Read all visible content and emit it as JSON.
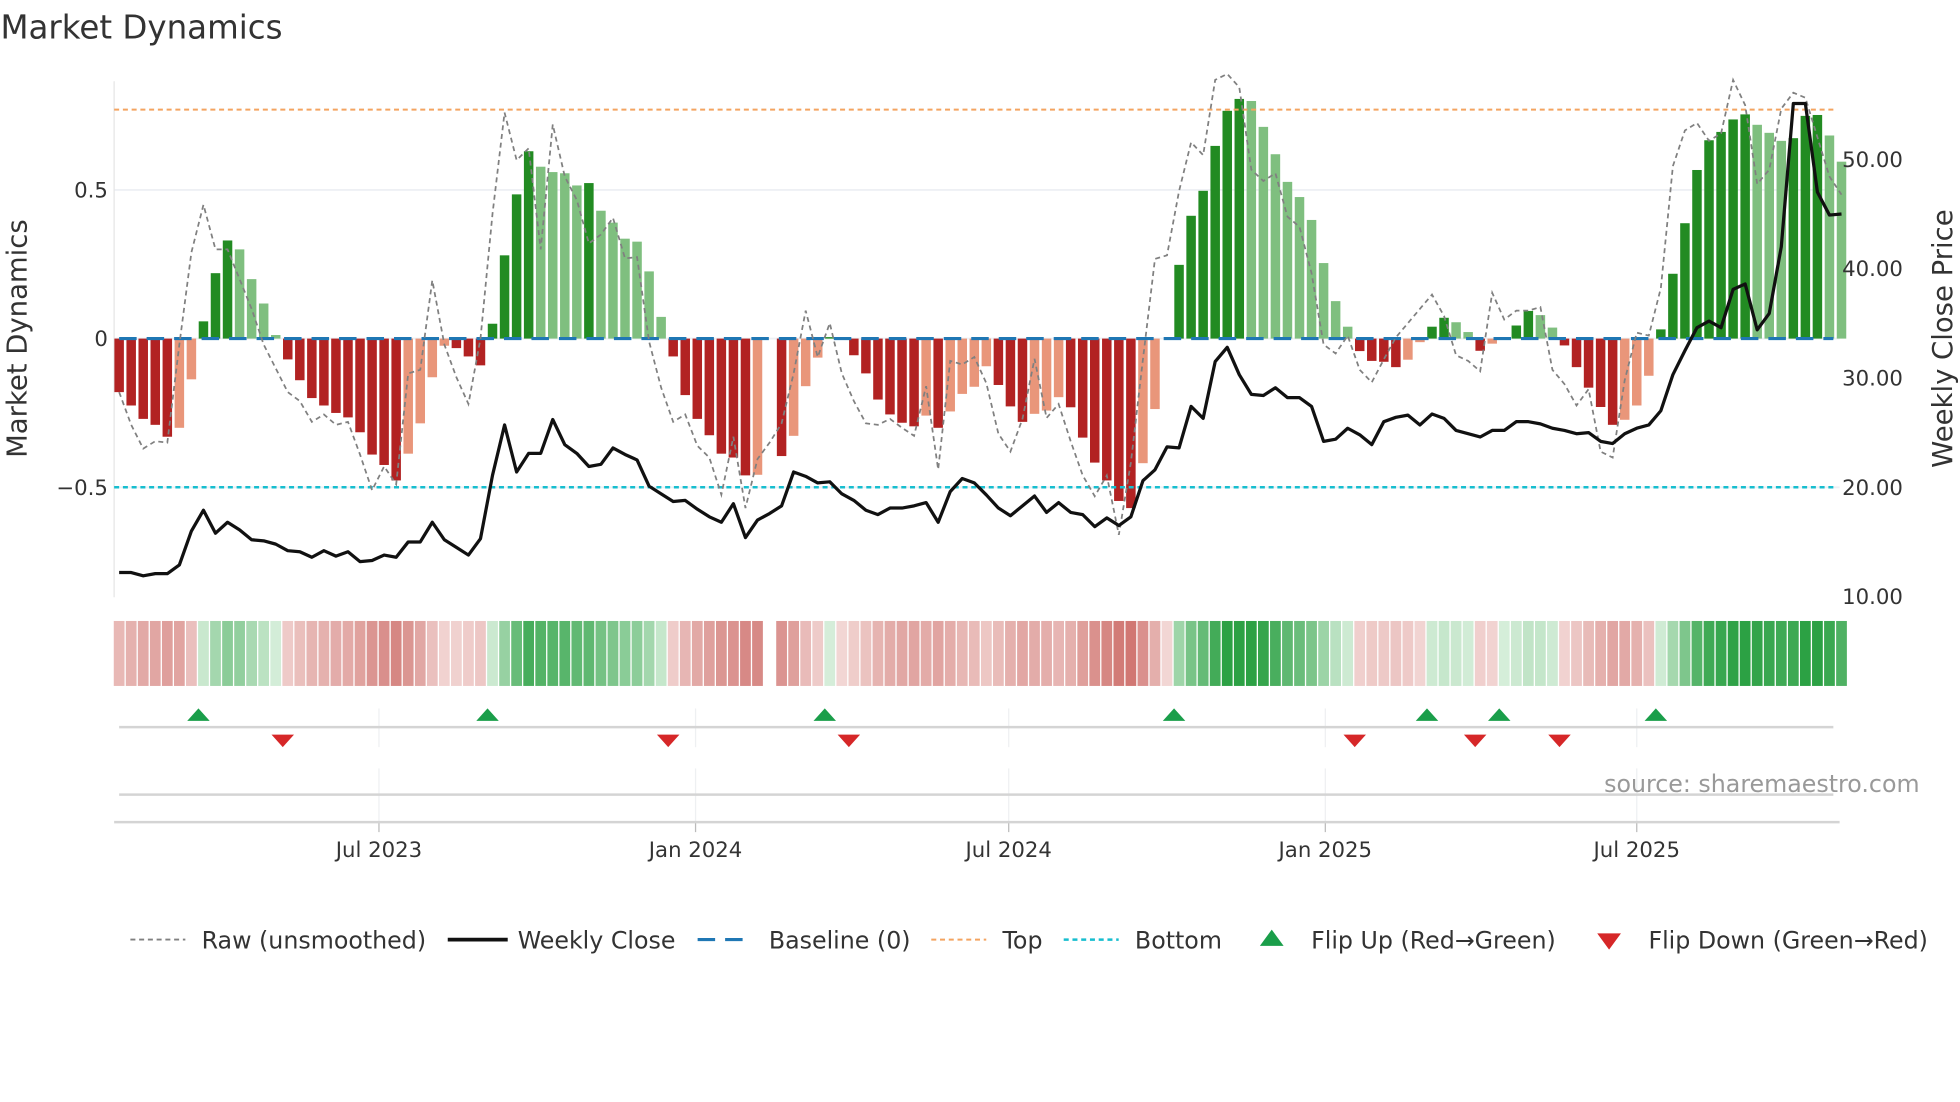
{
  "chart_data": {
    "type": "bar",
    "title": "Market Dynamics",
    "ylabel": "Market Dynamics",
    "ylabel_right": "Weekly Close Price",
    "ylim": [
      -0.87,
      0.87
    ],
    "ylim_right": [
      10,
      57
    ],
    "x_start": "2023-01-31",
    "x_step_days": 7,
    "left_ticks": [
      {
        "v": 0.5,
        "label": "0.5"
      },
      {
        "v": 0,
        "label": "0"
      },
      {
        "v": -0.5,
        "label": "−0.5"
      }
    ],
    "right_ticks": [
      {
        "v": 50,
        "label": "50.00"
      },
      {
        "v": 40,
        "label": "40.00"
      },
      {
        "v": 30,
        "label": "30.00"
      },
      {
        "v": 20,
        "label": "20.00"
      },
      {
        "v": 10,
        "label": "10.00"
      }
    ],
    "x_ticks": [
      {
        "date": "2023-07-01",
        "label": "Jul 2023"
      },
      {
        "date": "2024-01-01",
        "label": "Jan 2024"
      },
      {
        "date": "2024-07-01",
        "label": "Jul 2024"
      },
      {
        "date": "2025-01-01",
        "label": "Jan 2025"
      },
      {
        "date": "2025-07-01",
        "label": "Jul 2025"
      }
    ],
    "top_level": 0.77,
    "bottom_level": -0.5,
    "baseline": 0,
    "colors": {
      "dark_green": "#228b22",
      "light_green": "#7fbf7f",
      "dark_red": "#b22222",
      "light_red": "#e9967a",
      "baseline": "#1f77b4",
      "top": "#f4a460",
      "bottom": "#17becf",
      "raw": "#808080",
      "close": "#111111",
      "flip_up": "#1a9e4a",
      "flip_down": "#d62728"
    },
    "momentum": [
      -0.18,
      -0.225,
      -0.27,
      -0.29,
      -0.33,
      -0.3,
      -0.137,
      0.058,
      0.22,
      0.33,
      0.3,
      0.2,
      0.118,
      0.012,
      -0.07,
      -0.14,
      -0.2,
      -0.225,
      -0.25,
      -0.265,
      -0.315,
      -0.39,
      -0.425,
      -0.477,
      -0.387,
      -0.285,
      -0.13,
      -0.024,
      -0.032,
      -0.06,
      -0.09,
      0.05,
      0.28,
      0.485,
      0.63,
      0.578,
      0.56,
      0.556,
      0.515,
      0.523,
      0.43,
      0.39,
      0.336,
      0.326,
      0.226,
      0.073,
      -0.06,
      -0.19,
      -0.27,
      -0.325,
      -0.387,
      -0.4,
      -0.46,
      -0.458,
      null,
      -0.395,
      -0.327,
      -0.16,
      -0.064,
      0.005,
      0,
      -0.056,
      -0.117,
      -0.205,
      -0.255,
      -0.283,
      -0.295,
      -0.259,
      -0.3,
      -0.245,
      -0.186,
      -0.162,
      -0.093,
      -0.156,
      -0.228,
      -0.28,
      -0.253,
      -0.242,
      -0.197,
      -0.231,
      -0.333,
      -0.417,
      -0.477,
      -0.546,
      -0.57,
      -0.419,
      -0.237,
      0,
      0.248,
      0.413,
      0.497,
      0.648,
      0.766,
      0.806,
      0.799,
      0.712,
      0.62,
      0.527,
      0.476,
      0.399,
      0.254,
      0.126,
      0.04,
      -0.042,
      -0.075,
      -0.078,
      -0.096,
      -0.071,
      -0.012,
      0.04,
      0.07,
      0.055,
      0.022,
      -0.041,
      -0.017,
      0.004,
      0.044,
      0.093,
      0.079,
      0.037,
      -0.023,
      -0.096,
      -0.165,
      -0.23,
      -0.29,
      -0.273,
      -0.225,
      -0.125,
      0.031,
      0.218,
      0.388,
      0.567,
      0.667,
      0.695,
      0.737,
      0.754,
      0.719,
      0.692,
      0.665,
      0.674,
      0.749,
      0.752,
      0.683,
      0.595
    ],
    "raw": [
      -0.18,
      -0.29,
      -0.37,
      -0.345,
      -0.35,
      -0.02,
      0.29,
      0.45,
      0.3,
      0.3,
      0.2,
      0.1,
      -0.02,
      -0.1,
      -0.18,
      -0.21,
      -0.28,
      -0.255,
      -0.29,
      -0.28,
      -0.39,
      -0.51,
      -0.43,
      -0.49,
      -0.117,
      -0.105,
      0.196,
      -0.02,
      -0.13,
      -0.22,
      0.0,
      0.42,
      0.76,
      0.6,
      0.64,
      0.3,
      0.72,
      0.545,
      0.466,
      0.32,
      0.35,
      0.406,
      0.27,
      0.274,
      -0.01,
      -0.165,
      -0.28,
      -0.255,
      -0.36,
      -0.4,
      -0.525,
      -0.33,
      -0.57,
      -0.405,
      -0.35,
      -0.285,
      -0.117,
      0.094,
      -0.062,
      0.052,
      -0.117,
      -0.21,
      -0.285,
      -0.29,
      -0.27,
      -0.3,
      -0.327,
      -0.16,
      -0.44,
      -0.075,
      -0.087,
      -0.062,
      -0.15,
      -0.32,
      -0.38,
      -0.27,
      -0.068,
      -0.267,
      -0.22,
      -0.345,
      -0.46,
      -0.53,
      -0.46,
      -0.66,
      -0.417,
      -0.07,
      0.268,
      0.28,
      0.496,
      0.66,
      0.617,
      0.87,
      0.89,
      0.845,
      0.568,
      0.53,
      0.556,
      0.41,
      0.376,
      0.22,
      -0.02,
      -0.05,
      0.01,
      -0.105,
      -0.147,
      -0.07,
      0.004,
      0.052,
      0.1,
      0.148,
      0.076,
      -0.056,
      -0.075,
      -0.11,
      0.154,
      0.064,
      0.094,
      0.094,
      0.106,
      -0.105,
      -0.153,
      -0.225,
      -0.17,
      -0.38,
      -0.4,
      -0.14,
      0.02,
      0.01,
      0.17,
      0.58,
      0.7,
      0.725,
      0.665,
      0.69,
      0.87,
      0.785,
      0.52,
      0.568,
      0.773,
      0.827,
      0.81,
      0.677,
      0.545,
      0.484
    ],
    "close": [
      12.2,
      12.2,
      11.9,
      12.1,
      12.1,
      12.9,
      16.0,
      17.9,
      15.8,
      16.8,
      16.1,
      15.2,
      15.1,
      14.8,
      14.2,
      14.1,
      13.6,
      14.2,
      13.7,
      14.1,
      13.2,
      13.3,
      13.8,
      13.6,
      15.0,
      15.0,
      16.8,
      15.2,
      14.5,
      13.8,
      15.3,
      21.1,
      25.7,
      21.4,
      23.1,
      23.1,
      26.2,
      23.9,
      23.1,
      21.9,
      22.1,
      23.6,
      23.0,
      22.5,
      20.1,
      19.4,
      18.7,
      18.8,
      18.0,
      17.3,
      16.8,
      18.5,
      15.4,
      17.0,
      17.6,
      18.3,
      21.4,
      21.0,
      20.4,
      20.5,
      19.4,
      18.8,
      17.9,
      17.5,
      18.1,
      18.1,
      18.3,
      18.6,
      16.8,
      19.6,
      20.8,
      20.4,
      19.3,
      18.1,
      17.4,
      18.3,
      19.2,
      17.7,
      18.6,
      17.7,
      17.5,
      16.4,
      17.2,
      16.5,
      17.3,
      20.6,
      21.6,
      23.7,
      23.6,
      27.4,
      26.3,
      31.5,
      32.8,
      30.3,
      28.5,
      28.4,
      29.1,
      28.2,
      28.2,
      27.4,
      24.2,
      24.4,
      25.4,
      24.8,
      23.9,
      26.0,
      26.4,
      26.6,
      25.7,
      26.7,
      26.3,
      25.2,
      24.9,
      24.6,
      25.2,
      25.2,
      26.0,
      26.0,
      25.8,
      25.4,
      25.2,
      24.9,
      25.0,
      24.2,
      24.0,
      24.9,
      25.4,
      25.7,
      27.0,
      30.3,
      32.5,
      34.6,
      35.2,
      34.6,
      38.1,
      38.6,
      34.4,
      35.9,
      42.0,
      55.1,
      55.1,
      47.0,
      44.9,
      45.0
    ],
    "flip_up_weeks": [
      7,
      31,
      59,
      88,
      109,
      115,
      128
    ],
    "flip_down_weeks": [
      14,
      46,
      61,
      103,
      113,
      120
    ],
    "legend": [
      {
        "key": "raw",
        "label": "Raw (unsmoothed)"
      },
      {
        "key": "close",
        "label": "Weekly Close"
      },
      {
        "key": "baseline",
        "label": "Baseline (0)"
      },
      {
        "key": "top",
        "label": "Top"
      },
      {
        "key": "bottom",
        "label": "Bottom"
      },
      {
        "key": "flip_up",
        "label": "Flip Up (Red→Green)"
      },
      {
        "key": "flip_down",
        "label": "Flip Down (Green→Red)"
      }
    ],
    "source": "source: sharemaestro.com"
  }
}
